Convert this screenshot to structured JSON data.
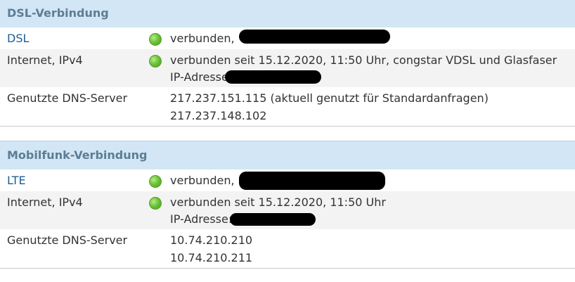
{
  "sections": [
    {
      "title": "DSL-Verbindung",
      "rows": [
        {
          "label": "DSL",
          "lines": [
            "verbunden, "
          ]
        },
        {
          "label": "Internet, IPv4",
          "lines": [
            "verbunden seit 15.12.2020, 11:50 Uhr, congstar VDSL und Glasfaser",
            "IP-Adresse:"
          ]
        },
        {
          "label": "Genutzte DNS-Server",
          "lines": [
            "217.237.151.115 (aktuell genutzt für Standardanfragen)",
            "217.237.148.102"
          ]
        }
      ]
    },
    {
      "title": "Mobilfunk-Verbindung",
      "rows": [
        {
          "label": "LTE",
          "lines": [
            "verbunden, "
          ]
        },
        {
          "label": "Internet, IPv4",
          "lines": [
            "verbunden seit 15.12.2020, 11:50 Uhr",
            "IP-Adresse:"
          ]
        },
        {
          "label": "Genutzte DNS-Server",
          "lines": [
            "10.74.210.210",
            "10.74.210.211"
          ]
        }
      ]
    }
  ],
  "colors": {
    "header_bg": "#d2e6f5",
    "header_text": "#5d7d95",
    "link": "#1f5d94",
    "status_ok": "#6ec43a"
  },
  "icons": {
    "status": "green-status-led-icon"
  }
}
